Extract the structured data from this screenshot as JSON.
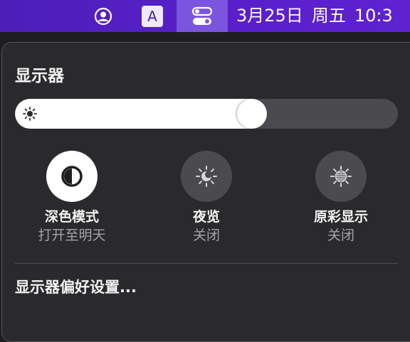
{
  "menubar": {
    "icons": [
      "user-icon",
      "input-source-icon",
      "control-center-icon"
    ],
    "input_source_letter": "A",
    "date": "3月25日",
    "weekday": "周五",
    "time": "10:3",
    "bg_color": "#5a1fcc"
  },
  "panel": {
    "title": "显示器",
    "brightness": {
      "level": 0.63,
      "icon": "sun-icon"
    },
    "modes": [
      {
        "label": "深色模式",
        "sub": "打开至明天",
        "icon": "dark-mode-icon",
        "active": true
      },
      {
        "label": "夜览",
        "sub": "关闭",
        "icon": "night-shift-icon",
        "active": false
      },
      {
        "label": "原彩显示",
        "sub": "关闭",
        "icon": "true-tone-icon",
        "active": false
      }
    ],
    "prefs_link": "显示器偏好设置..."
  }
}
